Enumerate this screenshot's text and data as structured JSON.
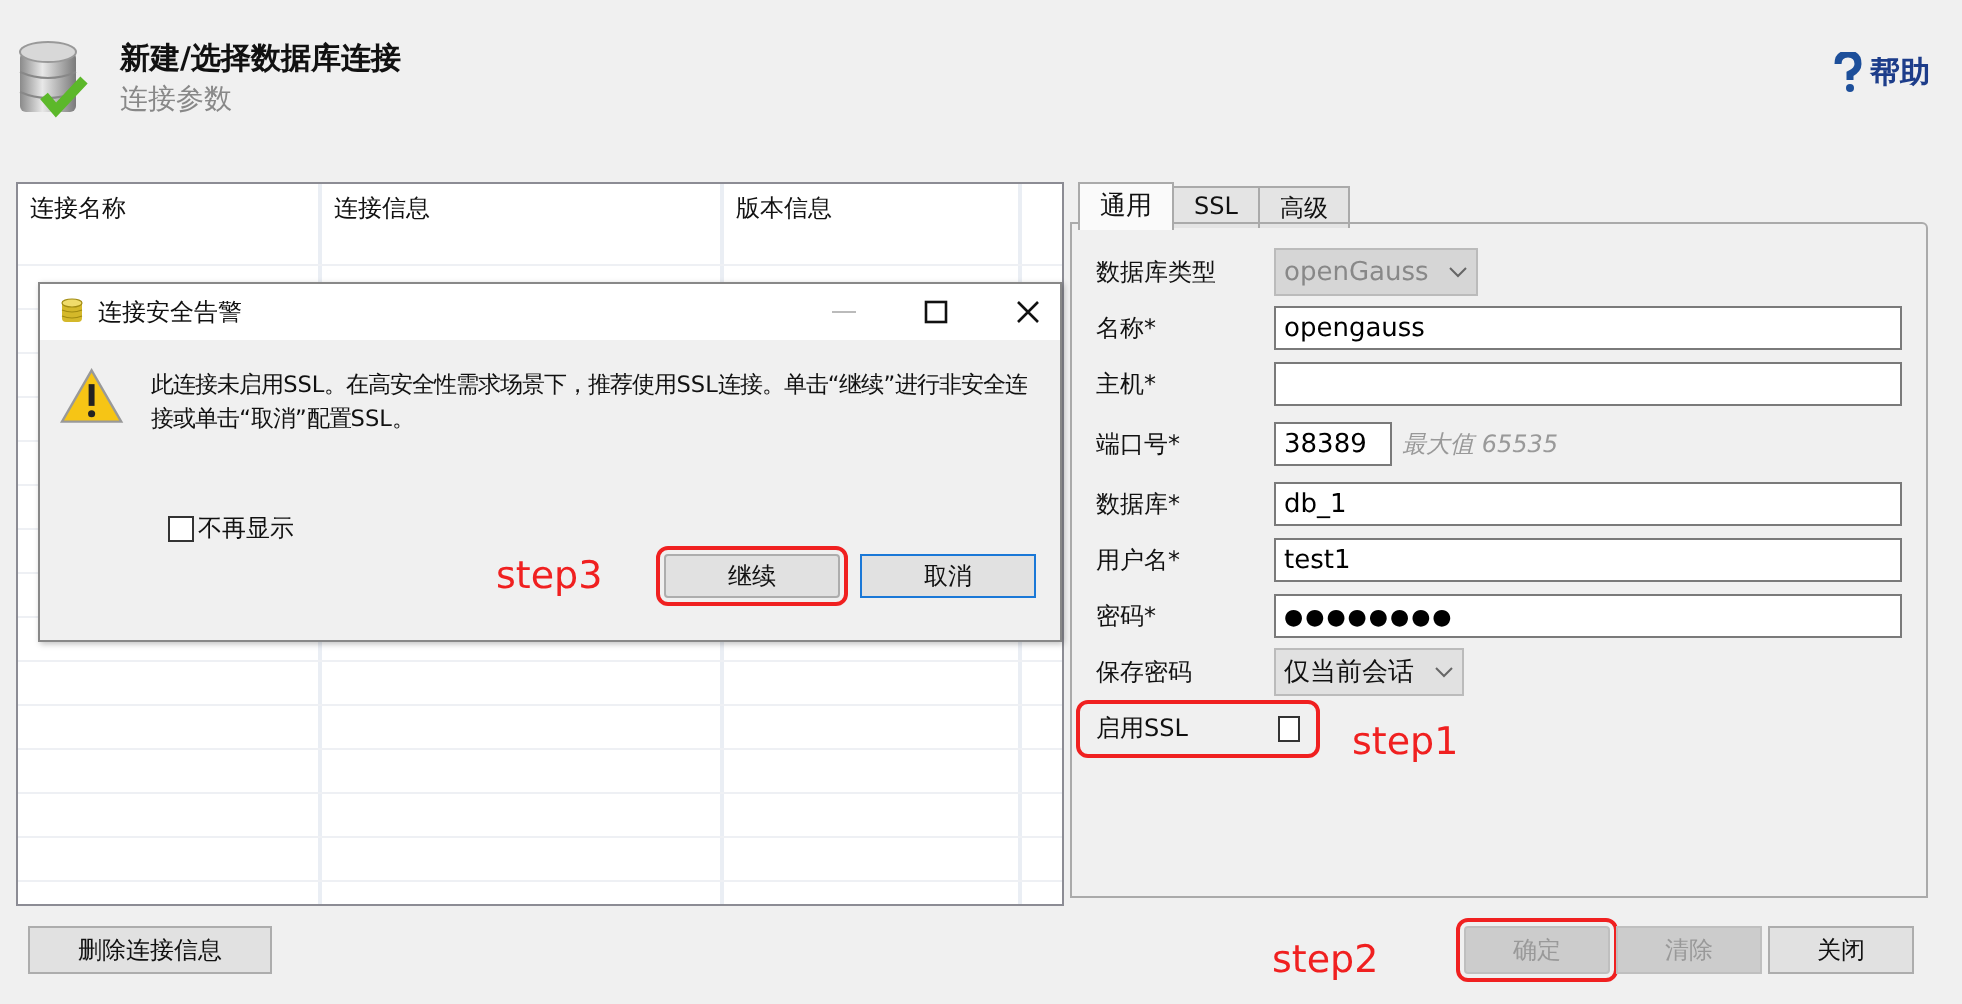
{
  "header": {
    "title": "新建/选择数据库连接",
    "subtitle": "连接参数",
    "help": "帮助"
  },
  "table": {
    "columns": [
      "连接名称",
      "连接信息",
      "版本信息"
    ]
  },
  "delete_button": "删除连接信息",
  "tabs": [
    {
      "label": "通用",
      "selected": true
    },
    {
      "label": "SSL",
      "selected": false
    },
    {
      "label": "高级",
      "selected": false
    }
  ],
  "fields": [
    {
      "kind": "select",
      "label": "数据库类型",
      "value": "openGauss",
      "disabled": true
    },
    {
      "kind": "text",
      "label": "名称*",
      "value": "opengauss"
    },
    {
      "kind": "text",
      "label": "主机*"
    },
    {
      "kind": "port",
      "label": "端口号*",
      "value": "38389",
      "hint": "最大值 65535"
    },
    {
      "kind": "text",
      "label": "数据库*",
      "value": "db_1"
    },
    {
      "kind": "text",
      "label": "用户名*",
      "value": "test1"
    },
    {
      "kind": "password",
      "label": "密码*",
      "value": "●●●●●●●●"
    },
    {
      "kind": "select",
      "label": "保存密码",
      "value": "仅当前会话",
      "disabled": false
    },
    {
      "kind": "checkbox",
      "label": "启用SSL",
      "checked": false,
      "annotation": "step1"
    }
  ],
  "buttons": [
    {
      "label": "确定",
      "disabled": true,
      "annotation": "step2"
    },
    {
      "label": "清除",
      "disabled": true
    },
    {
      "label": "关闭",
      "disabled": false
    }
  ],
  "dialog": {
    "title": "连接安全告警",
    "message": "此连接未启用SSL。在高安全性需求场景下，推荐使用SSL连接。单击“继续”进行非安全连接或单击“取消”配置SSL。",
    "checkbox": {
      "label": "不再显示",
      "checked": false
    },
    "buttons": [
      {
        "label": "继续",
        "focused": false,
        "annotation": "step3"
      },
      {
        "label": "取消",
        "focused": true
      }
    ]
  }
}
